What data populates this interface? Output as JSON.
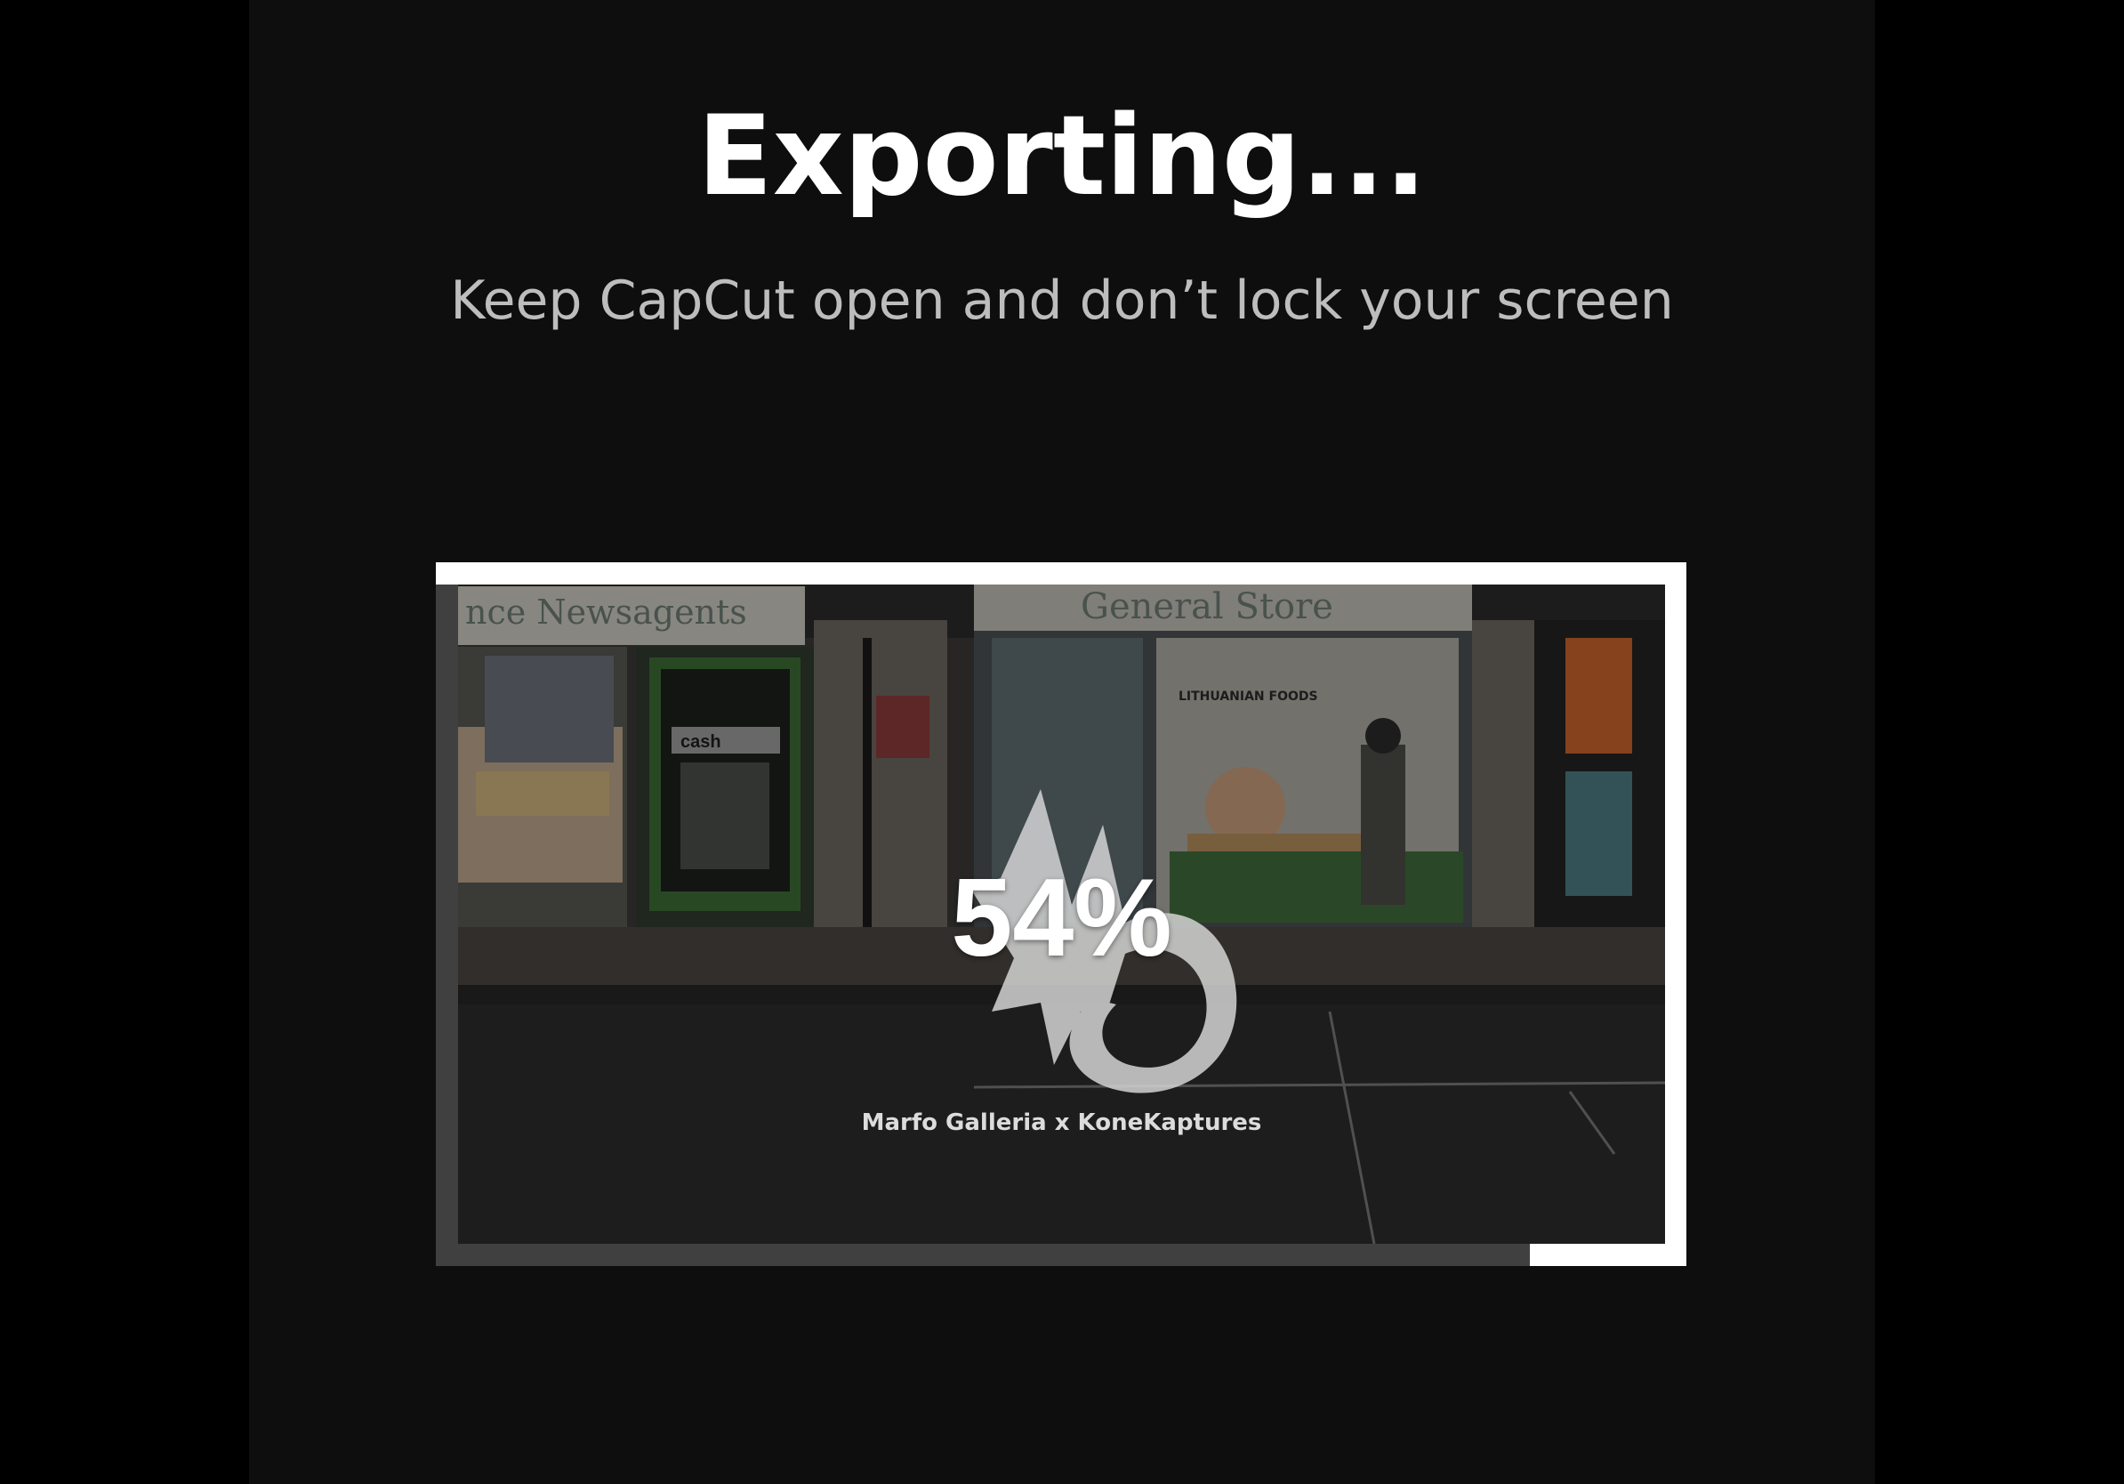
{
  "export_screen": {
    "title": "Exporting...",
    "subtitle": "Keep CapCut open and don’t lock your screen"
  },
  "progress": {
    "percent_text": "54%",
    "fraction": 0.54
  },
  "preview": {
    "watermark": "Marfo Galleria x KoneKaptures",
    "logo_icon": "flame-swirl-logo-icon",
    "signs": {
      "newsagents": "nce   Newsagents",
      "general_store": "General Store",
      "cash": "cash",
      "lithuanian_foods": "LITHUANIAN FOODS"
    }
  },
  "colors": {
    "background": "#0e0e0e",
    "progress_fill": "#ffffff",
    "progress_track": "#404040"
  }
}
